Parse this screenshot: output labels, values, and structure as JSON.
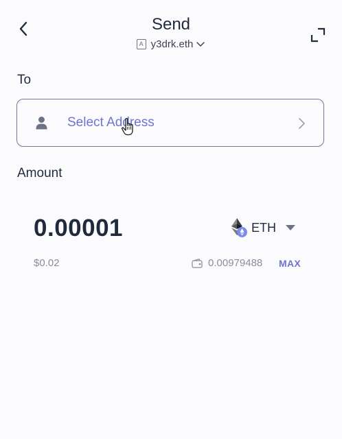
{
  "header": {
    "title": "Send",
    "account_badge": "A",
    "account_name": "y3drk.eth",
    "icons": {
      "back": "chevron-left-icon",
      "expand": "expand-icon",
      "account_dropdown": "chevron-down-icon"
    }
  },
  "to_section": {
    "label": "To",
    "placeholder": "Select Address",
    "icons": {
      "person": "person-icon",
      "next": "chevron-right-icon"
    }
  },
  "amount_section": {
    "label": "Amount",
    "value": "0.00001",
    "token": {
      "symbol": "ETH",
      "icon": "ethereum-icon"
    },
    "fiat_value": "$0.02",
    "balance": "0.00979488",
    "max_label": "MAX"
  },
  "colors": {
    "accent": "#6f73d2",
    "text_primary": "#1f2a3d",
    "text_secondary": "#8a8f9c",
    "border": "#6e77a0",
    "background": "#fbfafd"
  }
}
